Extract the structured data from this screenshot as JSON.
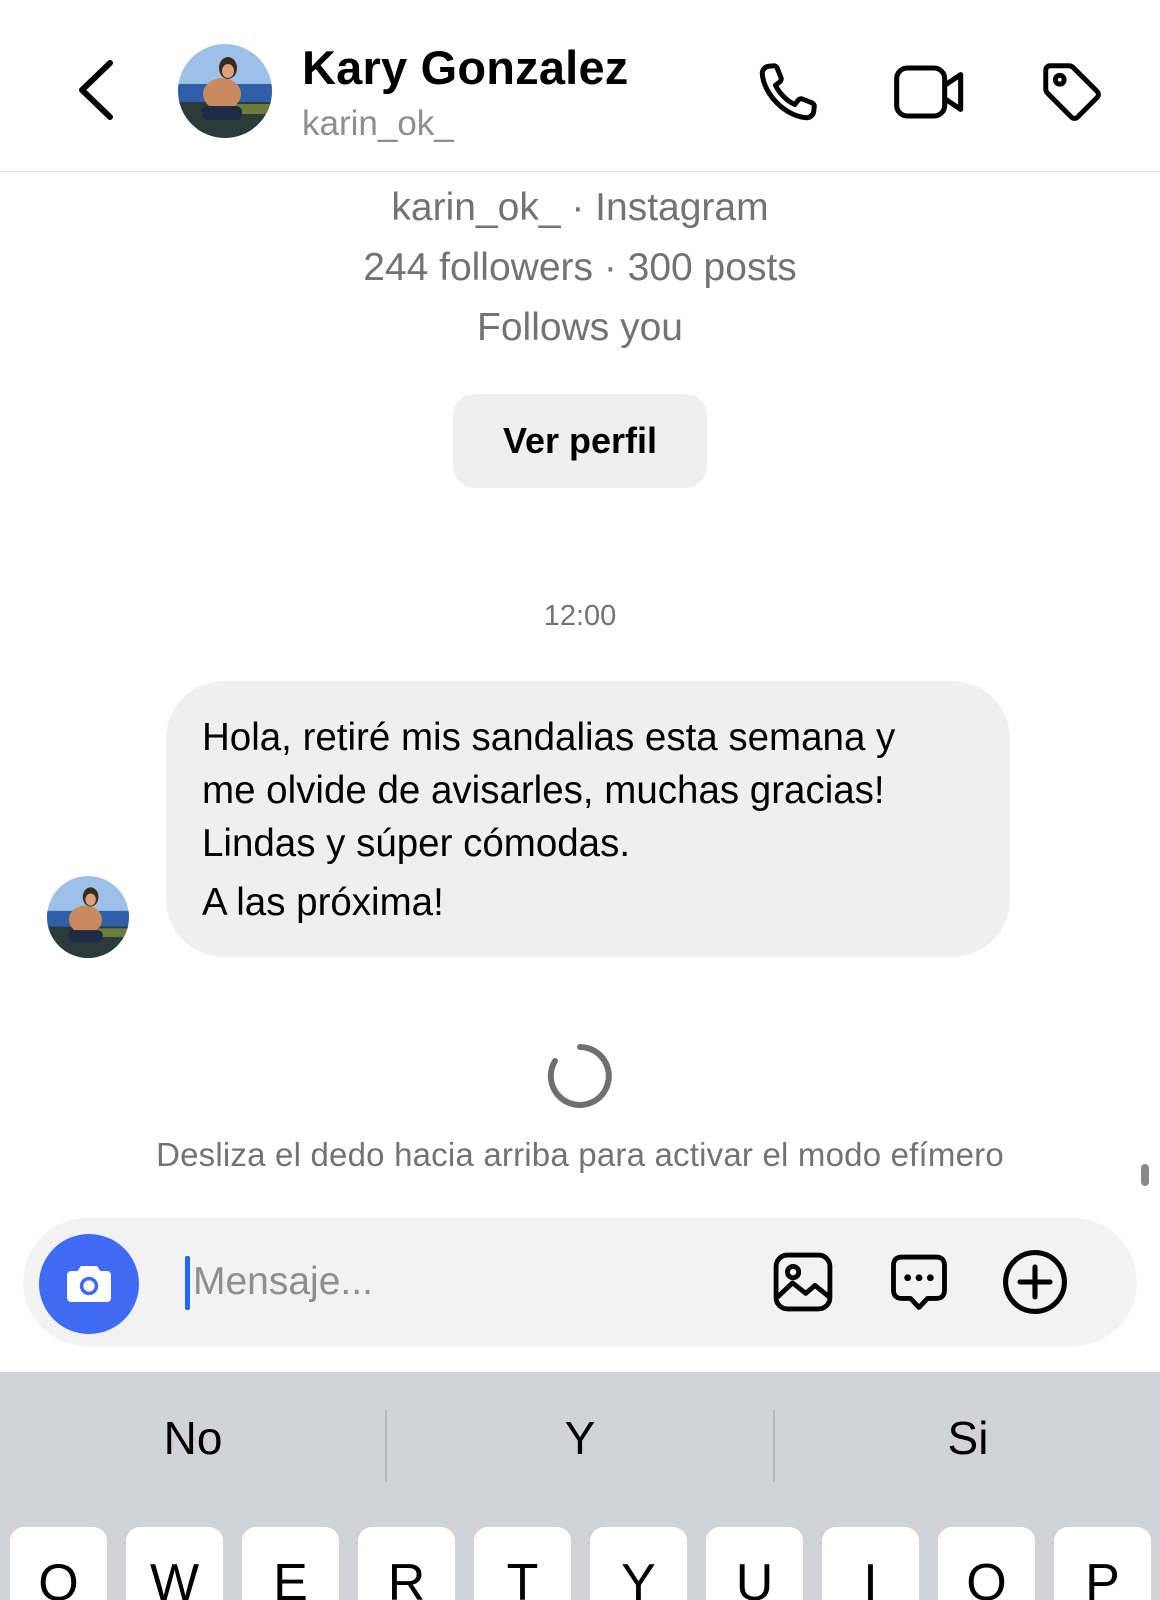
{
  "header": {
    "back_icon": "chevron-left-icon",
    "avatar": "profile-photo",
    "name": "Kary Gonzalez",
    "handle": "karin_ok_",
    "actions": [
      "phone-icon",
      "video-camera-icon",
      "tag-icon"
    ]
  },
  "profile": {
    "line1": "karin_ok_ · Instagram",
    "line2": "244 followers · 300 posts",
    "line3": "Follows you",
    "view_profile_label": "Ver perfil"
  },
  "conversation": {
    "timestamp": "12:00",
    "messages": [
      {
        "from": "Kary Gonzalez",
        "lines": [
          "Hola, retiré mis sandalias esta semana y",
          "me olvide de avisarles, muchas gracias!",
          "Lindas y súper cómodas.",
          "A las próxima!"
        ]
      }
    ],
    "hint": "Desliza el dedo hacia arriba para activar el modo efímero"
  },
  "composer": {
    "camera_icon": "camera-icon",
    "placeholder": "Mensaje...",
    "value": "",
    "icons": [
      "image-icon",
      "message-dots-icon",
      "plus-circle-icon"
    ]
  },
  "keyboard": {
    "suggestions": [
      "No",
      "Y",
      "Si"
    ],
    "keys": [
      "Q",
      "W",
      "E",
      "R",
      "T",
      "Y",
      "U",
      "I",
      "O",
      "P"
    ]
  },
  "colors": {
    "accent": "#3e6af5",
    "caret": "#1f6bf0",
    "bubble": "#efefef",
    "secondary_text": "#737373",
    "keyboard_bg": "#d1d3d9"
  }
}
